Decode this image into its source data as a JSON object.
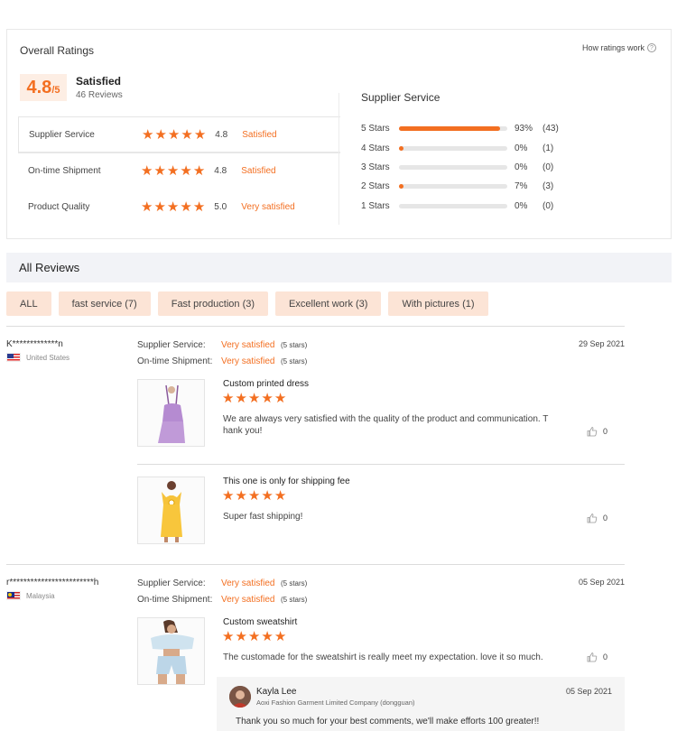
{
  "overall": {
    "title": "Overall Ratings",
    "how_link": "How ratings work",
    "score": "4.8",
    "score_max": "/5",
    "label": "Satisfied",
    "review_count": "46 Reviews"
  },
  "metrics": [
    {
      "label": "Supplier Service",
      "score": "4.8",
      "word": "Satisfied"
    },
    {
      "label": "On-time Shipment",
      "score": "4.8",
      "word": "Satisfied"
    },
    {
      "label": "Product Quality",
      "score": "5.0",
      "word": "Very satisfied"
    }
  ],
  "distribution": {
    "title": "Supplier Service",
    "rows": [
      {
        "label": "5 Stars",
        "pct": "93%",
        "count": "(43)",
        "fill": 0.93
      },
      {
        "label": "4 Stars",
        "pct": "0%",
        "count": "(1)",
        "fill": 0.04
      },
      {
        "label": "3 Stars",
        "pct": "0%",
        "count": "(0)",
        "fill": 0
      },
      {
        "label": "2 Stars",
        "pct": "7%",
        "count": "(3)",
        "fill": 0.04
      },
      {
        "label": "1 Stars",
        "pct": "0%",
        "count": "(0)",
        "fill": 0
      }
    ]
  },
  "all_reviews": {
    "title": "All Reviews",
    "filters": [
      "ALL",
      "fast service (7)",
      "Fast production (3)",
      "Excellent work (3)",
      "With pictures (1)"
    ]
  },
  "reviews": [
    {
      "name": "K*************n",
      "country": "United States",
      "date": "29 Sep 2021",
      "supplier_label": "Supplier Service:",
      "supplier_value": "Very satisfied",
      "supplier_note": "(5 stars)",
      "shipment_label": "On-time Shipment:",
      "shipment_value": "Very satisfied",
      "shipment_note": "(5 stars)",
      "items": [
        {
          "title": "Custom printed dress",
          "text": "We are always very satisfied with the quality of the product and communication. T hank you!",
          "likes": "0"
        },
        {
          "title": "This one is only for shipping fee",
          "text": "Super fast shipping!",
          "likes": "0"
        }
      ]
    },
    {
      "name": "r************************h",
      "country": "Malaysia",
      "date": "05 Sep 2021",
      "supplier_label": "Supplier Service:",
      "supplier_value": "Very satisfied",
      "supplier_note": "(5 stars)",
      "shipment_label": "On-time Shipment:",
      "shipment_value": "Very satisfied",
      "shipment_note": "(5 stars)",
      "items": [
        {
          "title": "Custom sweatshirt",
          "text": "The customade for the sweatshirt is really meet my expectation. love it so much.",
          "likes": "0"
        }
      ],
      "reply": {
        "name": "Kayla Lee",
        "company": "Aoxi Fashion Garment Limited Company (dongguan)",
        "date": "05 Sep 2021",
        "text": "Thank you so much for your best comments, we'll make efforts 100 greater!!"
      }
    }
  ],
  "colors": {
    "accent": "#f36f21",
    "score_bg": "#fdeee4",
    "chip_bg": "#fce4d6"
  },
  "icons": [
    "question-icon",
    "star-icon",
    "thumbs-up-icon",
    "us-flag-icon",
    "malaysia-flag-icon"
  ]
}
